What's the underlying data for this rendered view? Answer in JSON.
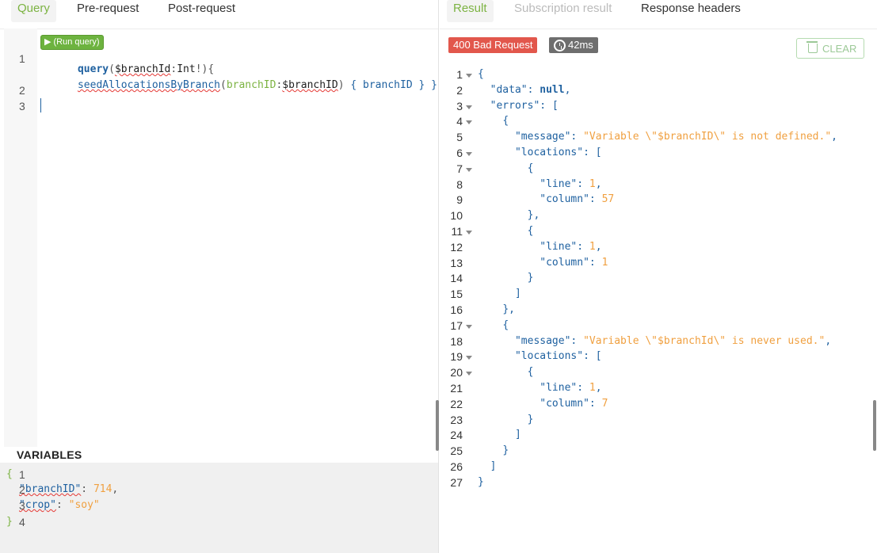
{
  "left_tabs": [
    "Query",
    "Pre-request",
    "Post-request"
  ],
  "run_query_label": "▶ (Run query)",
  "query": {
    "line_numbers": [
      "1",
      "2",
      "3"
    ],
    "line1": {
      "kw": "query",
      "p1": "(",
      "var": "$branchId",
      "p2": ":",
      "type": "Int",
      "p3": "!){"
    },
    "line1b": {
      "fn": "seedAllocationsByBranch",
      "p1": "(",
      "arg": "branchID",
      "p2": ":",
      "var": "$branchID",
      "p3": ")",
      "rest": "{ branchID } }"
    }
  },
  "variables": {
    "title": "VARIABLES",
    "line_numbers": [
      "1",
      "2",
      "3",
      "4"
    ],
    "open": "{",
    "close": "}",
    "k1": "\"branchID\"",
    "v1": "714",
    "c1": ",",
    "k2": "\"crop\"",
    "v2": "\"soy\"",
    "colon": ": "
  },
  "right_tabs": [
    "Result",
    "Subscription result",
    "Response headers"
  ],
  "status_badge": "400 Bad Request",
  "time_badge": "42ms",
  "clear_label": "CLEAR",
  "result_lines": [
    {
      "n": "1",
      "fold": true,
      "text": "{"
    },
    {
      "n": "2",
      "fold": false,
      "text": "  \"data\": null,"
    },
    {
      "n": "3",
      "fold": true,
      "text": "  \"errors\": ["
    },
    {
      "n": "4",
      "fold": true,
      "text": "    {"
    },
    {
      "n": "5",
      "fold": false,
      "text": "      \"message\": \"Variable \\\"$branchID\\\" is not defined.\","
    },
    {
      "n": "6",
      "fold": true,
      "text": "      \"locations\": ["
    },
    {
      "n": "7",
      "fold": true,
      "text": "        {"
    },
    {
      "n": "8",
      "fold": false,
      "text": "          \"line\": 1,"
    },
    {
      "n": "9",
      "fold": false,
      "text": "          \"column\": 57"
    },
    {
      "n": "10",
      "fold": false,
      "text": "        },"
    },
    {
      "n": "11",
      "fold": true,
      "text": "        {"
    },
    {
      "n": "12",
      "fold": false,
      "text": "          \"line\": 1,"
    },
    {
      "n": "13",
      "fold": false,
      "text": "          \"column\": 1"
    },
    {
      "n": "14",
      "fold": false,
      "text": "        }"
    },
    {
      "n": "15",
      "fold": false,
      "text": "      ]"
    },
    {
      "n": "16",
      "fold": false,
      "text": "    },"
    },
    {
      "n": "17",
      "fold": true,
      "text": "    {"
    },
    {
      "n": "18",
      "fold": false,
      "text": "      \"message\": \"Variable \\\"$branchId\\\" is never used.\","
    },
    {
      "n": "19",
      "fold": true,
      "text": "      \"locations\": ["
    },
    {
      "n": "20",
      "fold": true,
      "text": "        {"
    },
    {
      "n": "21",
      "fold": false,
      "text": "          \"line\": 1,"
    },
    {
      "n": "22",
      "fold": false,
      "text": "          \"column\": 7"
    },
    {
      "n": "23",
      "fold": false,
      "text": "        }"
    },
    {
      "n": "24",
      "fold": false,
      "text": "      ]"
    },
    {
      "n": "25",
      "fold": false,
      "text": "    }"
    },
    {
      "n": "26",
      "fold": false,
      "text": "  ]"
    },
    {
      "n": "27",
      "fold": false,
      "text": "}"
    }
  ],
  "colors": {
    "accent_green": "#7cb342",
    "error_red": "#e2574c",
    "key_blue": "#1f61a0",
    "value_orange": "#f0a040"
  }
}
